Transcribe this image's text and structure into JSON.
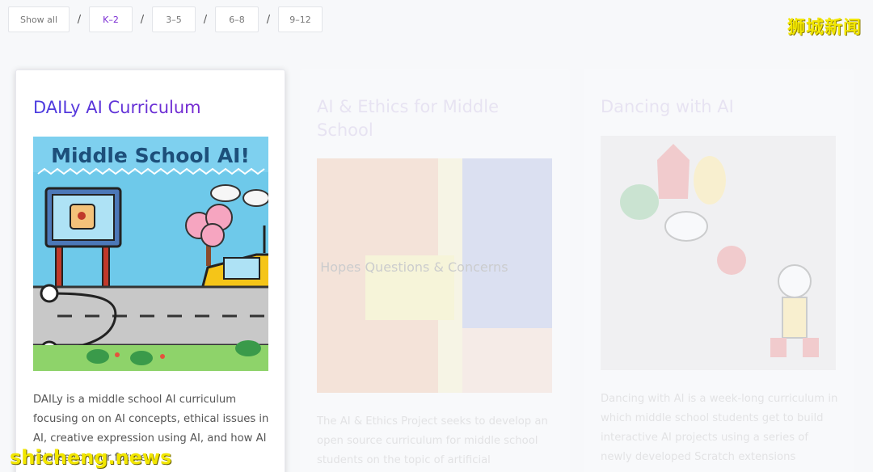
{
  "filters": [
    {
      "label": "Show all",
      "active": false
    },
    {
      "label": "K–2",
      "active": true
    },
    {
      "label": "3–5",
      "active": false
    },
    {
      "label": "6–8",
      "active": false
    },
    {
      "label": "9–12",
      "active": false
    }
  ],
  "separator": "/",
  "watermark_top": "狮城新闻",
  "watermark_bottom": "shicheng.news",
  "cards": [
    {
      "title": "DAILy AI Curriculum",
      "image_text": "Middle School AI!",
      "description": "DAILy is a middle school AI curriculum focusing on on AI concepts, ethical issues in AI, creative expression using AI, and how AI relates to your future...",
      "state": "active"
    },
    {
      "title": "AI & Ethics for Middle School",
      "image_text": "AI Hopes Questions & Concerns",
      "description": "The AI & Ethics Project seeks to develop an open source curriculum for middle school students on the topic of artificial intelligence",
      "state": "faded"
    },
    {
      "title": "Dancing with AI",
      "description": "Dancing with AI is a week-long curriculum in which middle school students get to build interactive AI projects using a series of newly developed Scratch extensions",
      "state": "faded"
    }
  ],
  "colors": {
    "accent": "#7a2bd3",
    "title_gradient_start": "#4a3ce0",
    "title_gradient_end": "#8a1fc9",
    "watermark": "#f2e600"
  }
}
